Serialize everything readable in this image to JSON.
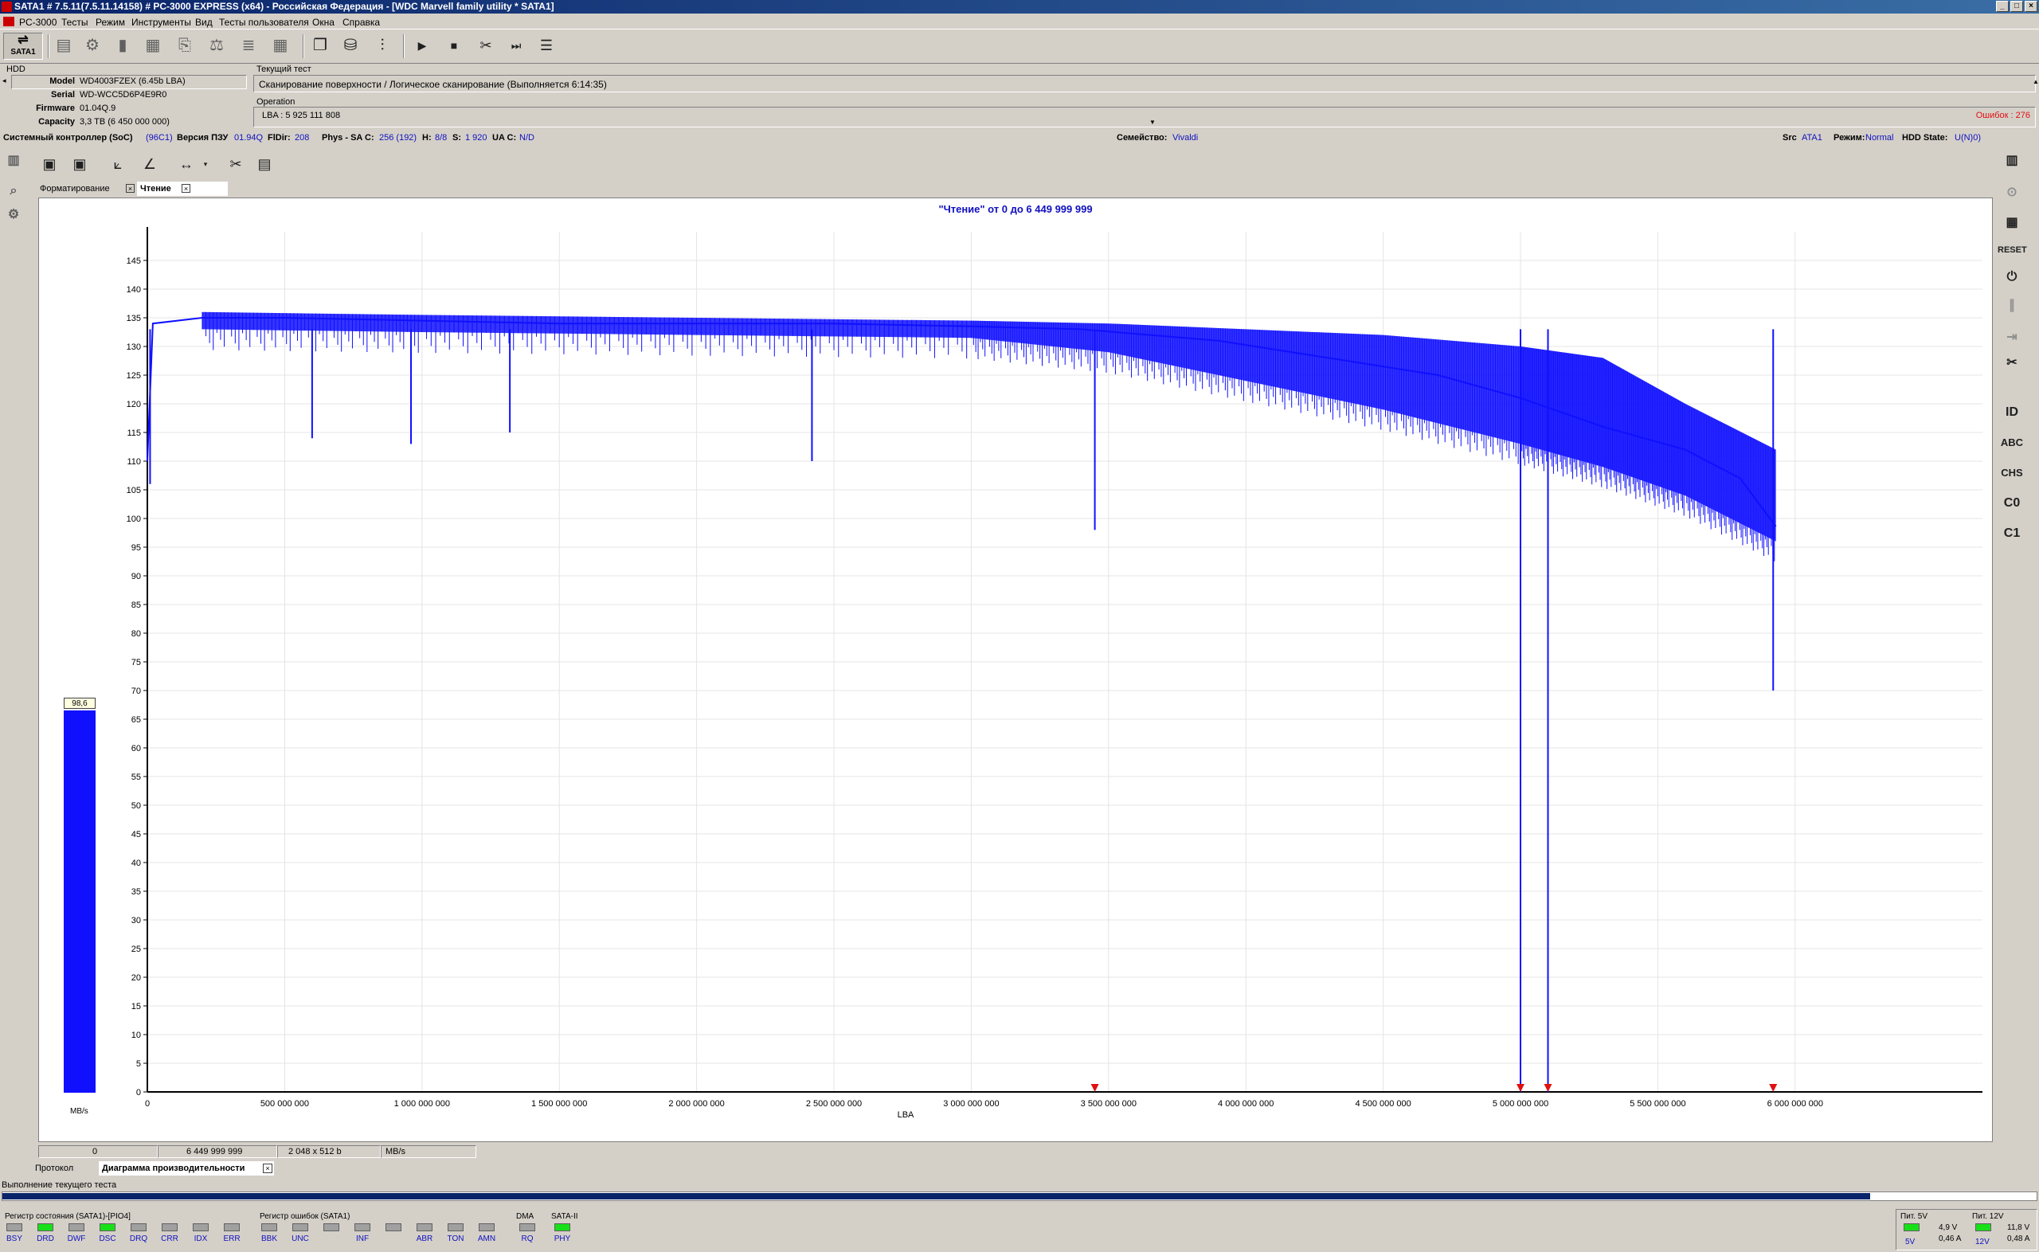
{
  "titlebar": {
    "text": "SATA1 # 7.5.11(7.5.11.14158) # PC-3000 EXPRESS (x64) - Российская Федерация - [WDC Marvell family utility * SATA1]"
  },
  "menu": [
    "PC-3000",
    "Тесты",
    "Режим",
    "Инструменты",
    "Вид",
    "Тесты пользователя",
    "Окна",
    "Справка"
  ],
  "toolbar": {
    "sata_label": "SATA1"
  },
  "hdd": {
    "header": "HDD",
    "fields": [
      {
        "key": "Model",
        "value": "WD4003FZEX (6.45b LBA)"
      },
      {
        "key": "Serial",
        "value": "WD-WCC5D6P4E9R0"
      },
      {
        "key": "Firmware",
        "value": "01.04Q.9"
      },
      {
        "key": "Capacity",
        "value": "3,3 TB (6 450 000 000)"
      }
    ]
  },
  "current_test": {
    "header": "Текущий тест",
    "name": "Сканирование поверхности / Логическое сканирование (Выполняется 6:14:35)",
    "operation_header": "Operation",
    "lba": "LBA : 5 925 111 808",
    "errors": "Ошибок : 276"
  },
  "status": {
    "soc_label": "Системный контроллер (SoC)",
    "soc_value": "(96C1)",
    "rom_label": "Версия ПЗУ",
    "rom_value": "01.94Q",
    "fldir_label": "FlDir:",
    "fldir_value": "208",
    "phys_label": "Phys - SA C:",
    "phys_value": "256 (192)",
    "h_label": "H:",
    "h_value": "8/8",
    "s_label": "S:",
    "s_value": "1 920",
    "uac_label": "UA C:",
    "uac_value": "N/D",
    "family_label": "Семейство:",
    "family_value": "Vivaldi",
    "src_label": "Src",
    "src_value": "ATA1",
    "mode_label": "Режим:",
    "mode_value": "Normal",
    "state_label": "HDD State:",
    "state_value": "U(N)0)"
  },
  "tabs_top": [
    {
      "label": "Форматирование"
    },
    {
      "label": "Чтение"
    }
  ],
  "gauge": {
    "value": 98.6,
    "value_label": "98,6",
    "unit": "MB/s",
    "max": 150
  },
  "chart_data": {
    "type": "line",
    "title": "\"Чтение\" от 0 до 6 449 999 999",
    "xlabel": "LBA",
    "ylabel": "",
    "xlim": [
      0,
      6450000000
    ],
    "ylim": [
      0,
      150
    ],
    "x_ticks": [
      0,
      500000000,
      1000000000,
      1500000000,
      2000000000,
      2500000000,
      3000000000,
      3500000000,
      4000000000,
      4500000000,
      5000000000,
      5500000000,
      6000000000
    ],
    "x_tick_labels": [
      "0",
      "500 000 000",
      "1 000 000 000",
      "1 500 000 000",
      "2 000 000 000",
      "2 500 000 000",
      "3 000 000 000",
      "3 500 000 000",
      "4 000 000 000",
      "4 500 000 000",
      "5 000 000 000",
      "5 500 000 000",
      "6 000 000 000"
    ],
    "y_ticks": [
      0,
      5,
      10,
      15,
      20,
      25,
      30,
      35,
      40,
      45,
      50,
      55,
      60,
      65,
      70,
      75,
      80,
      85,
      90,
      95,
      100,
      105,
      110,
      115,
      120,
      125,
      130,
      135,
      140,
      145
    ],
    "series": [
      {
        "values": [
          [
            0,
            110
          ],
          [
            20000000,
            134
          ],
          [
            200000000,
            135
          ],
          [
            500000000,
            135
          ],
          [
            1000000000,
            134.5
          ],
          [
            1500000000,
            134
          ],
          [
            2000000000,
            134
          ],
          [
            2500000000,
            134
          ],
          [
            3000000000,
            133.5
          ],
          [
            3400000000,
            133
          ],
          [
            3900000000,
            131
          ],
          [
            4300000000,
            128
          ],
          [
            4700000000,
            125
          ],
          [
            5000000000,
            121
          ],
          [
            5300000000,
            116
          ],
          [
            5600000000,
            112
          ],
          [
            5800000000,
            107
          ],
          [
            5930000000,
            98.6
          ]
        ],
        "band": [
          [
            200000000,
            136,
            133
          ],
          [
            1000000000,
            135.5,
            132.5
          ],
          [
            2000000000,
            135,
            132
          ],
          [
            3000000000,
            134.5,
            131.5
          ],
          [
            3500000000,
            134,
            129
          ],
          [
            4000000000,
            133,
            124
          ],
          [
            4500000000,
            132,
            119
          ],
          [
            5000000000,
            130,
            113
          ],
          [
            5300000000,
            128,
            109
          ],
          [
            5600000000,
            120,
            104
          ],
          [
            5930000000,
            112,
            96
          ]
        ]
      }
    ],
    "dips": [
      [
        10000000,
        106
      ],
      [
        600000000,
        114
      ],
      [
        960000000,
        113
      ],
      [
        1320000000,
        115
      ],
      [
        2420000000,
        110
      ],
      [
        3450000000,
        98
      ],
      [
        5000000000,
        0
      ],
      [
        5100000000,
        0
      ],
      [
        5920000000,
        70
      ]
    ],
    "markers": [
      3450000000,
      5000000000,
      5100000000,
      5920000000
    ],
    "marker_color": "#e01010",
    "series_color": "#1010ff",
    "grid": true
  },
  "axis_info": {
    "start": "0",
    "end": "6 449 999 999",
    "block": "2 048 x 512 b",
    "unit": "MB/s"
  },
  "tabs_bottom": [
    {
      "label": "Протокол"
    },
    {
      "label": "Диаграмма производительности"
    }
  ],
  "progress": {
    "label": "Выполнение текущего теста",
    "fraction": 0.918
  },
  "registers": {
    "state_title": "Регистр состояния (SATA1)-[PIO4]",
    "state": [
      {
        "name": "BSY",
        "on": false
      },
      {
        "name": "DRD",
        "on": true
      },
      {
        "name": "DWF",
        "on": false
      },
      {
        "name": "DSC",
        "on": true
      },
      {
        "name": "DRQ",
        "on": false
      },
      {
        "name": "CRR",
        "on": false
      },
      {
        "name": "IDX",
        "on": false
      },
      {
        "name": "ERR",
        "on": false
      }
    ],
    "error_title": "Регистр ошибок (SATA1)",
    "error": [
      {
        "name": "BBK",
        "on": false
      },
      {
        "name": "UNC",
        "on": false
      },
      {
        "name": "",
        "on": false
      },
      {
        "name": "INF",
        "on": false
      },
      {
        "name": "",
        "on": false
      },
      {
        "name": "ABR",
        "on": false
      },
      {
        "name": "TON",
        "on": false
      },
      {
        "name": "AMN",
        "on": false
      }
    ],
    "dma_title": "DMA",
    "dma": [
      {
        "name": "RQ",
        "on": false
      }
    ],
    "sata_title": "SATA-II",
    "sata": [
      {
        "name": "PHY",
        "on": true
      }
    ]
  },
  "power": {
    "p5_title": "Пит. 5V",
    "p5_v": "4,9 V",
    "p5_a": "0,46 A",
    "p5_led": "5V",
    "p12_title": "Пит. 12V",
    "p12_v": "11,8 V",
    "p12_a": "0,48 A",
    "p12_led": "12V"
  },
  "colors": {
    "accent": "#1010c0",
    "title_bar": "#0a246a",
    "error_text": "#e01010",
    "led_on": "#18e018"
  }
}
